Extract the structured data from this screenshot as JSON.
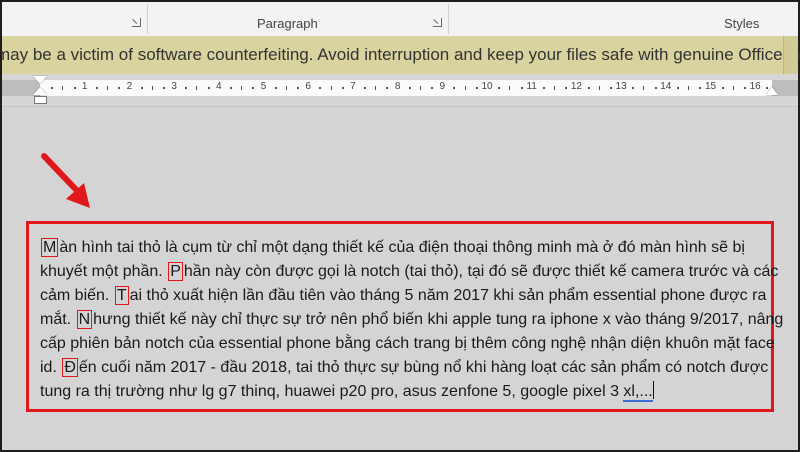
{
  "ribbon": {
    "groups": [
      "Paragraph",
      "Styles"
    ]
  },
  "warning": {
    "message": "may be a victim of software counterfeiting. Avoid interruption and keep your files safe with genuine Office today."
  },
  "ruler": {
    "numbers": [
      "1",
      "2",
      "3",
      "4",
      "5",
      "6",
      "7",
      "8",
      "9",
      "10",
      "11",
      "12",
      "13",
      "14",
      "15",
      "16"
    ]
  },
  "document": {
    "lines": [
      {
        "cap": "M",
        "text": "àn hình tai thỏ là cụm từ chỉ một dạng thiết kế của điện thoại thông minh mà ở đó màn hình sẽ bị"
      },
      {
        "text": "khuyết một phần. ",
        "cap": "P",
        "tail": "hần này còn được gọi là notch (tai thỏ), tại đó sẽ được thiết kế camera trước và các"
      },
      {
        "text": "cảm biến. ",
        "cap": "T",
        "tail": "ai thỏ xuất hiện lần đầu tiên vào tháng 5 năm 2017 khi sản phẩm essential phone được ra"
      },
      {
        "text": "mắt. ",
        "cap": "N",
        "tail": "hưng thiết kế này chỉ thực sự trở nên phổ biến khi apple tung ra iphone x vào tháng 9/2017, nâng"
      },
      {
        "text": "cấp phiên bản notch của essential phone bằng cách trang bị thêm công nghệ nhận diện khuôn mặt face"
      },
      {
        "text": "id. ",
        "cap": "Đ",
        "tail": "ến cuối năm 2017 - đầu 2018, tai thỏ thực sự bùng nổ khi hàng loạt các sản phẩm có notch được"
      },
      {
        "text": "tung ra thị trường như lg g7 thinq, huawei p20 pro, asus zenfone 5, google pixel 3 ",
        "spell": "xl,..."
      }
    ]
  },
  "colors": {
    "highlight": "#e0181b",
    "warning_bg": "#d9d3a0"
  },
  "icons": [
    "dialog-launcher-icon",
    "red-arrow-icon"
  ]
}
